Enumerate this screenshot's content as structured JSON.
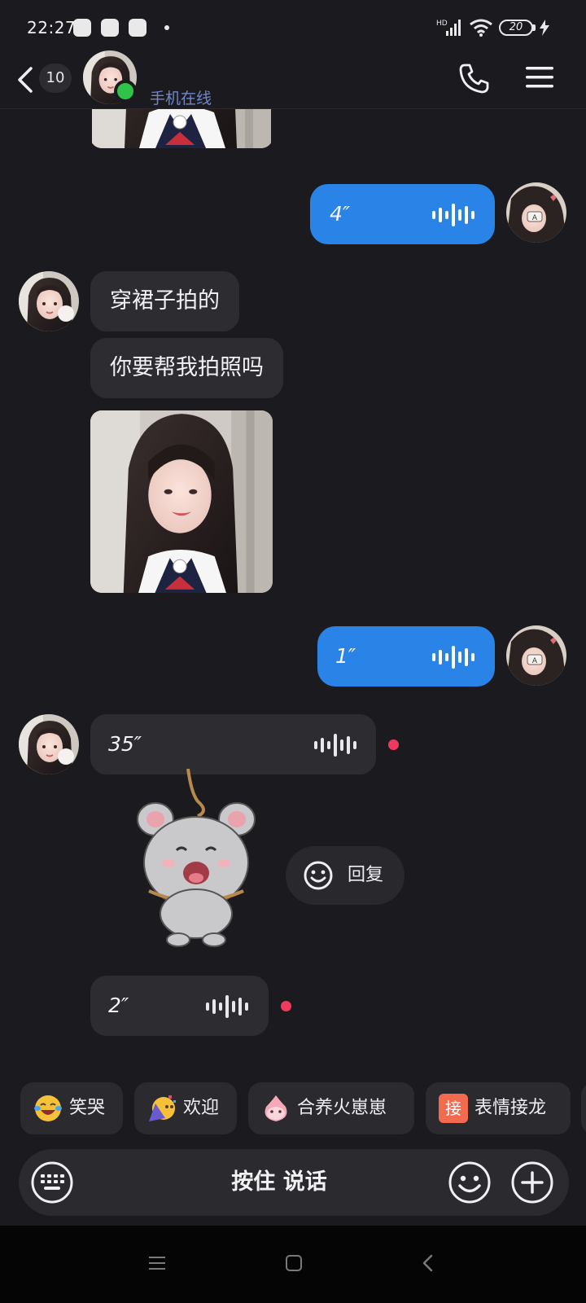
{
  "status_bar": {
    "time": "22:27",
    "battery": "20",
    "icons": [
      "app-notification-icon",
      "wechat-icon",
      "app-icon",
      "hd-signal-icon",
      "wifi-icon",
      "battery-icon",
      "charging-icon"
    ]
  },
  "header": {
    "unread_count": "10",
    "online_status": "手机在线",
    "icons": [
      "back-icon",
      "call-icon",
      "menu-icon"
    ]
  },
  "messages": [
    {
      "side": "in",
      "type": "photo",
      "partial": true
    },
    {
      "side": "out",
      "type": "voice",
      "duration": "4″"
    },
    {
      "side": "in",
      "type": "text",
      "text": "穿裙子拍的"
    },
    {
      "side": "in",
      "type": "text",
      "text": "你要帮我拍照吗"
    },
    {
      "side": "in",
      "type": "photo"
    },
    {
      "side": "out",
      "type": "voice",
      "duration": "1″"
    },
    {
      "side": "in",
      "type": "voice",
      "duration": "35″",
      "unread": true
    },
    {
      "side": "in",
      "type": "sticker",
      "sticker": "mouse-sticker"
    },
    {
      "side": "in",
      "type": "voice",
      "duration": "2″",
      "unread": true
    }
  ],
  "reply_chip": {
    "label": "回复"
  },
  "quick_replies": [
    {
      "label": "笑哭",
      "icon": "laugh-cry-emoji-icon"
    },
    {
      "label": "欢迎",
      "icon": "party-emoji-icon"
    },
    {
      "label": "合养火崽崽",
      "icon": "fire-pet-icon"
    },
    {
      "label": "表情接龙",
      "icon": "jie-badge-icon",
      "badge": "接"
    }
  ],
  "input_bar": {
    "hold_to_talk": "按住 说话"
  },
  "colors": {
    "background": "#1b1b1f",
    "outgoing_bubble": "#2a83e6",
    "incoming_bubble": "#2c2c31",
    "online": "#2fc34a",
    "unread_dot": "#f0395e",
    "online_text": "#6f86c8"
  }
}
